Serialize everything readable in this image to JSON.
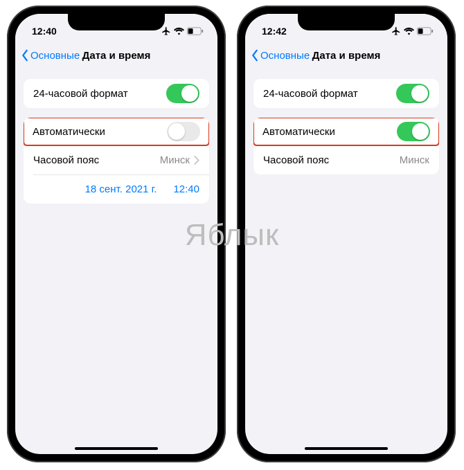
{
  "watermark": "Яблык",
  "phones": {
    "left": {
      "time": "12:40",
      "back_label": "Основные",
      "title": "Дата и время",
      "row_24h": "24-часовой формат",
      "toggle_24h_on": true,
      "row_auto": "Автоматически",
      "toggle_auto_on": false,
      "row_tz_label": "Часовой пояс",
      "row_tz_value": "Минск",
      "show_chevron": true,
      "date_value": "18 сент. 2021 г.",
      "time_value": "12:40"
    },
    "right": {
      "time": "12:42",
      "back_label": "Основные",
      "title": "Дата и время",
      "row_24h": "24-часовой формат",
      "toggle_24h_on": true,
      "row_auto": "Автоматически",
      "toggle_auto_on": true,
      "row_tz_label": "Часовой пояс",
      "row_tz_value": "Минск",
      "show_chevron": false
    }
  }
}
